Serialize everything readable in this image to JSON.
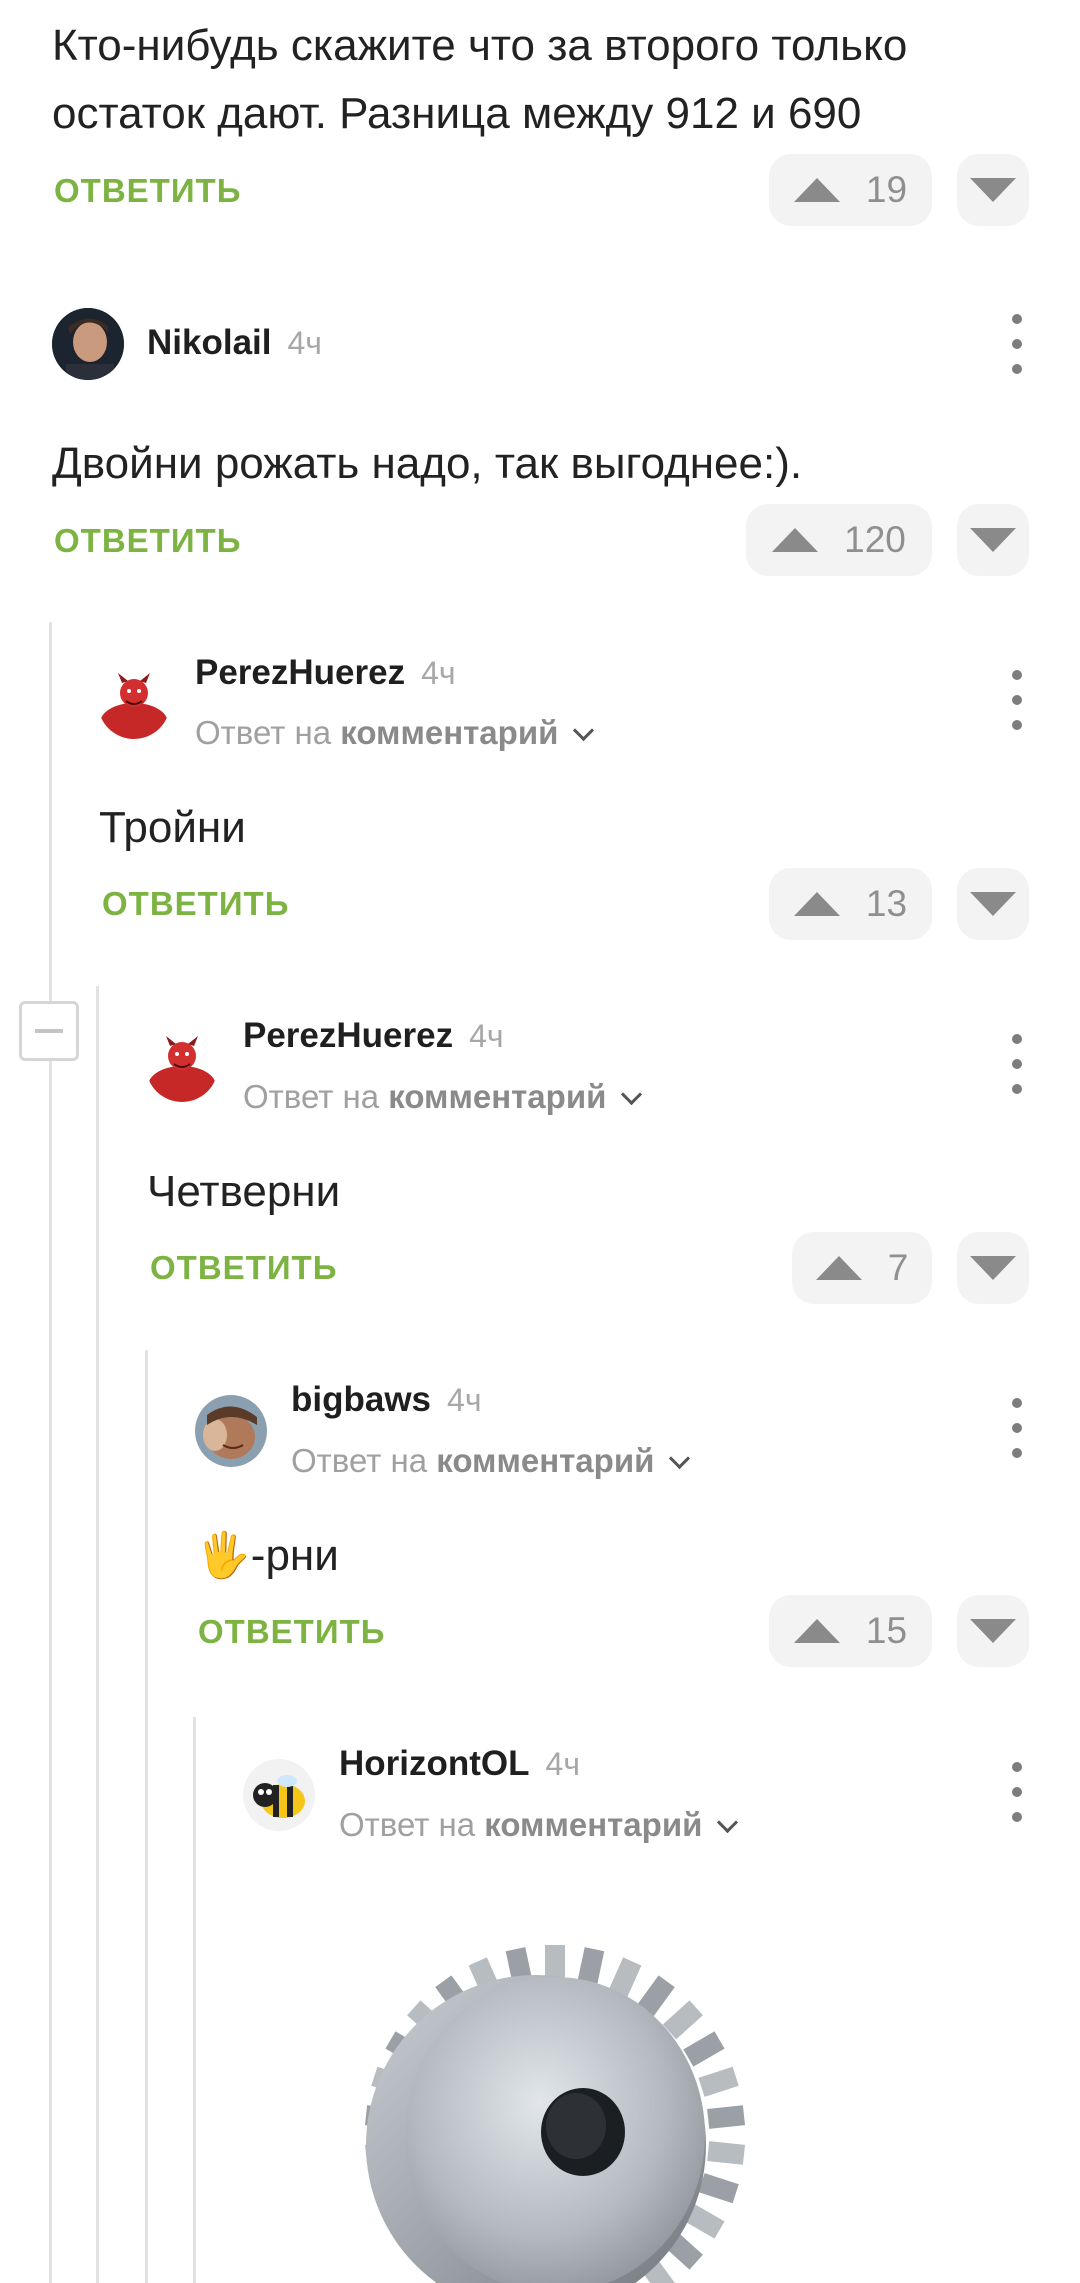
{
  "reply_label": "ОТВЕТИТЬ",
  "reply_prefix": "Ответ на",
  "reply_target": "комментарий",
  "comments": [
    {
      "text": "Кто-нибудь скажите что за второго только остаток дают. Разница между 912 и 690",
      "votes": "19"
    },
    {
      "author": "Nikolail",
      "time": "4ч",
      "text": "Двойни рожать надо, так выгоднее:).",
      "votes": "120",
      "avatar": "man-portrait"
    },
    {
      "author": "PerezHuerez",
      "time": "4ч",
      "text": "Тройни",
      "votes": "13",
      "avatar": "red-devil"
    },
    {
      "author": "PerezHuerez",
      "time": "4ч",
      "text": "Четверни",
      "votes": "7",
      "avatar": "red-devil"
    },
    {
      "author": "bigbaws",
      "time": "4ч",
      "text": "🖐-рни",
      "votes": "15",
      "avatar": "face-photo"
    },
    {
      "author": "HorizontOL",
      "time": "4ч",
      "avatar": "bee",
      "image": "gear-image"
    }
  ],
  "colors": {
    "accent": "#7cb342",
    "vote_bg": "#f3f3f3",
    "thread_line": "#e2e2e2"
  }
}
